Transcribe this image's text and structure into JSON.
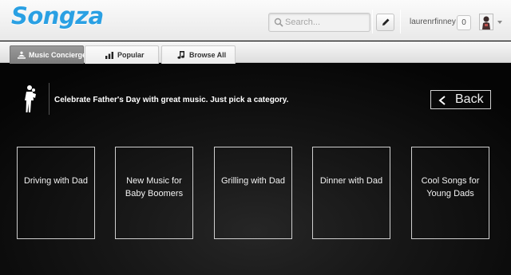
{
  "header": {
    "logo": "Songza",
    "search": {
      "placeholder": "Search..."
    },
    "username": "laurenrfinney",
    "count": "0"
  },
  "nav": {
    "tabs": [
      {
        "label": "Music Concierge",
        "icon": "concierge-icon",
        "active": true
      },
      {
        "label": "Popular",
        "icon": "bar-chart-icon",
        "active": false
      },
      {
        "label": "Browse All",
        "icon": "music-note-icon",
        "active": false
      }
    ]
  },
  "banner": {
    "text": "Celebrate Father's Day with great music. Just pick a category.",
    "icon": "father-child-icon"
  },
  "back_button": {
    "label": "Back",
    "icon": "chevron-left-icon"
  },
  "categories": [
    {
      "label": "Driving with Dad"
    },
    {
      "label": "New Music for Baby Boomers"
    },
    {
      "label": "Grilling with Dad"
    },
    {
      "label": "Dinner with Dad"
    },
    {
      "label": "Cool Songs for Young Dads"
    }
  ],
  "colors": {
    "brand": "#2aa0e3",
    "background": "#000000",
    "card_border": "#cfcfcf"
  }
}
